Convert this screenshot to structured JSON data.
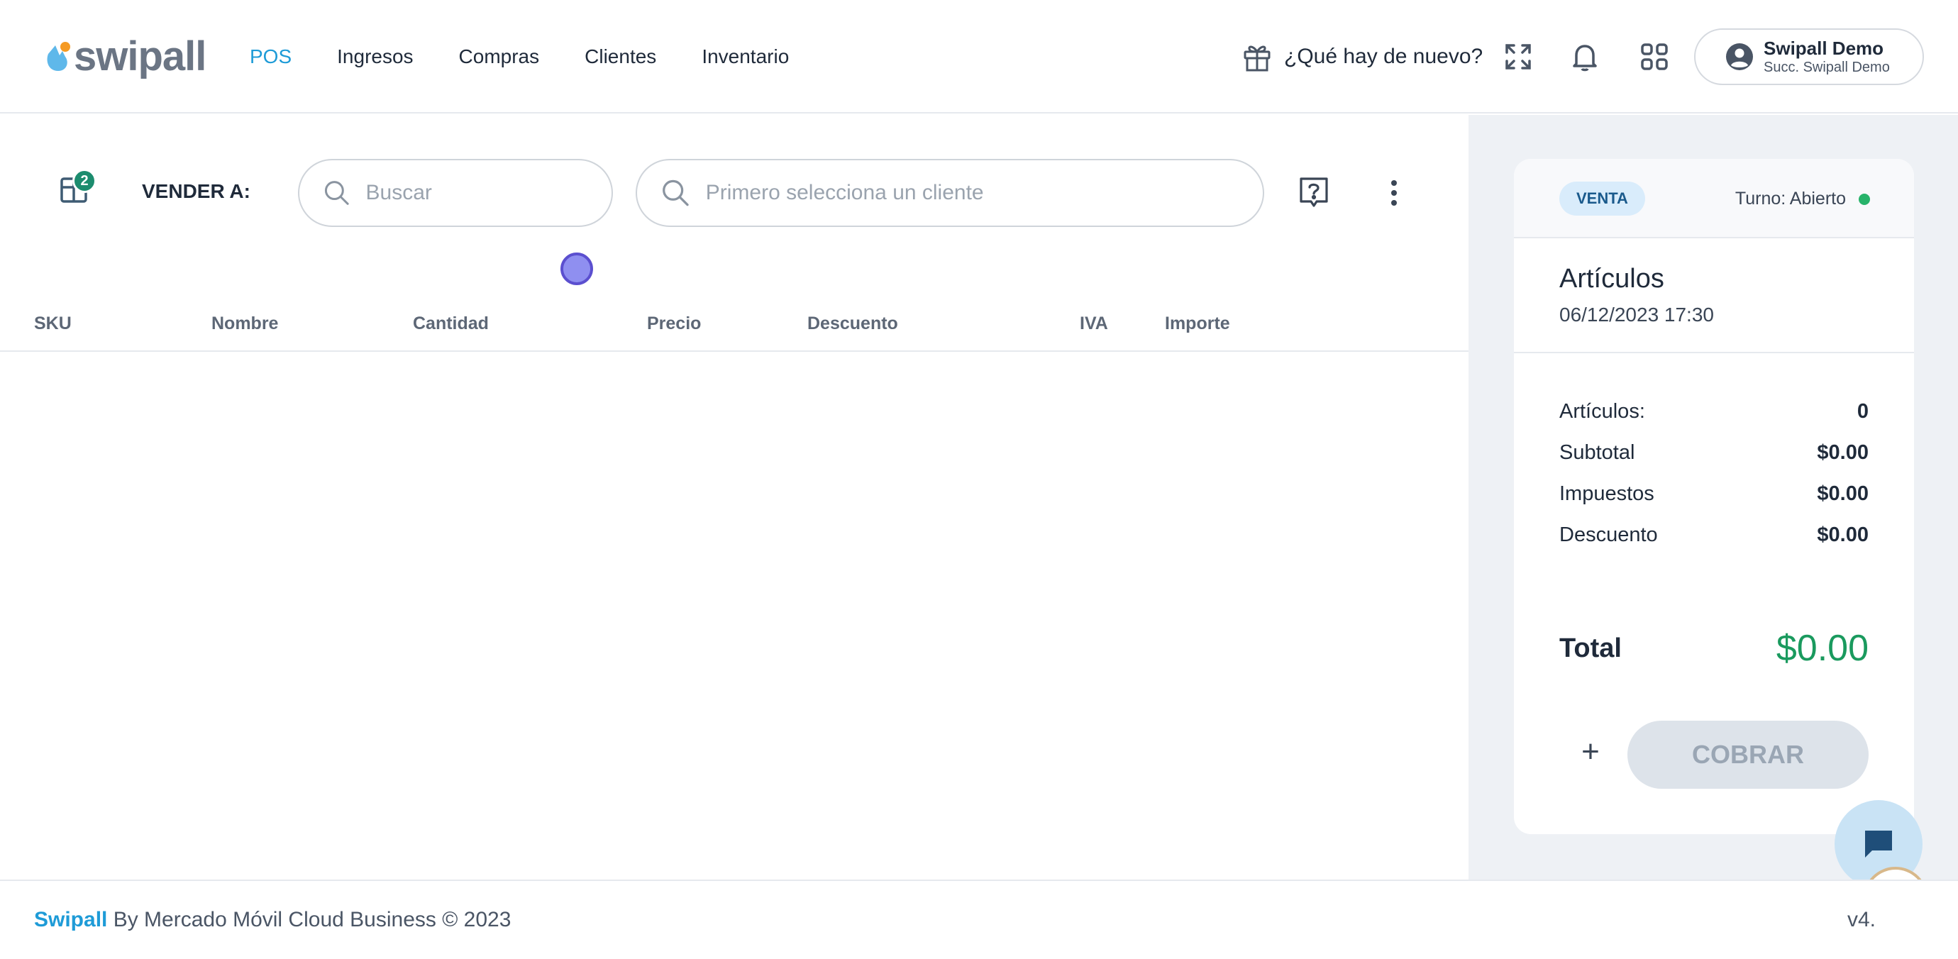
{
  "header": {
    "logo_text": "swipall",
    "nav": [
      {
        "label": "POS",
        "active": true
      },
      {
        "label": "Ingresos",
        "active": false
      },
      {
        "label": "Compras",
        "active": false
      },
      {
        "label": "Clientes",
        "active": false
      },
      {
        "label": "Inventario",
        "active": false
      }
    ],
    "whats_new": "¿Qué hay de nuevo?",
    "icons": [
      "gift-icon",
      "fullscreen-icon",
      "bell-icon",
      "apps-grid-icon",
      "user-circle-icon"
    ],
    "user": {
      "name": "Swipall Demo",
      "branch": "Succ. Swipall Demo"
    }
  },
  "toolbar": {
    "cart_badge": "2",
    "sell_to_label": "VENDER A:",
    "product_search_placeholder": "Buscar",
    "client_search_placeholder": "Primero selecciona un cliente"
  },
  "table": {
    "columns": [
      "SKU",
      "Nombre",
      "Cantidad",
      "Precio",
      "Descuento",
      "IVA",
      "Importe"
    ],
    "rows": []
  },
  "summary": {
    "sale_type": "VENTA",
    "shift": "Turno: Abierto",
    "shift_status_color": "#27b36a",
    "title": "Artículos",
    "datetime": "06/12/2023 17:30",
    "rows": [
      {
        "label": "Artículos:",
        "value": "0"
      },
      {
        "label": "Subtotal",
        "value": "$0.00"
      },
      {
        "label": "Impuestos",
        "value": "$0.00"
      },
      {
        "label": "Descuento",
        "value": "$0.00"
      }
    ],
    "total_label": "Total",
    "total_value": "$0.00",
    "add_label": "+",
    "charge_label": "COBRAR"
  },
  "footer": {
    "brand": "Swipall",
    "text": " By Mercado Móvil Cloud Business © 2023",
    "version": "v4."
  },
  "colors": {
    "accent": "#1e9bd7",
    "total": "#1a9a5e",
    "badge": "#1c8c6e"
  }
}
